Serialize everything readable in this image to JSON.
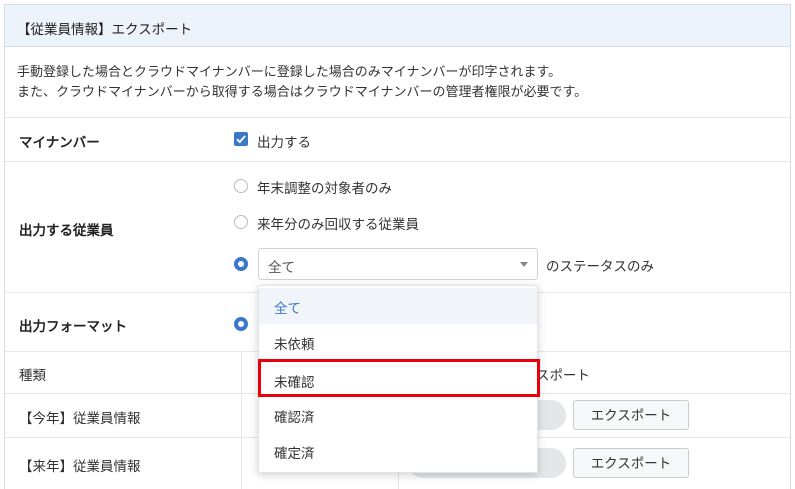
{
  "header": {
    "title": "【従業員情報】エクスポート"
  },
  "description": {
    "line1": "手動登録した場合とクラウドマイナンバーに登録した場合のみマイナンバーが印字されます。",
    "line2": "また、クラウドマイナンバーから取得する場合はクラウドマイナンバーの管理者権限が必要です。"
  },
  "mynumber": {
    "label": "マイナンバー",
    "checkbox_label": "出力する",
    "checked": true
  },
  "employees": {
    "label": "出力する従業員",
    "options": [
      "年末調整の対象者のみ",
      "来年分のみ回収する従業員"
    ],
    "status_select_value": "全て",
    "status_suffix": "のステータスのみ"
  },
  "format": {
    "label": "出力フォーマット"
  },
  "table": {
    "col_type": "種類",
    "col_export_partial": "スポート",
    "rows": [
      {
        "name": "【今年】従業員情報",
        "button": "エクスポート"
      },
      {
        "name": "【来年】従業員情報",
        "button": "エクスポート"
      }
    ]
  },
  "dropdown": {
    "options": [
      "全て",
      "未依頼",
      "未確認",
      "確認済",
      "確定済"
    ],
    "selected": "全て",
    "highlighted": "未確認"
  },
  "colors": {
    "accent": "#3a78c9",
    "highlight": "#e8000b",
    "header_bg": "#edf3fb"
  }
}
